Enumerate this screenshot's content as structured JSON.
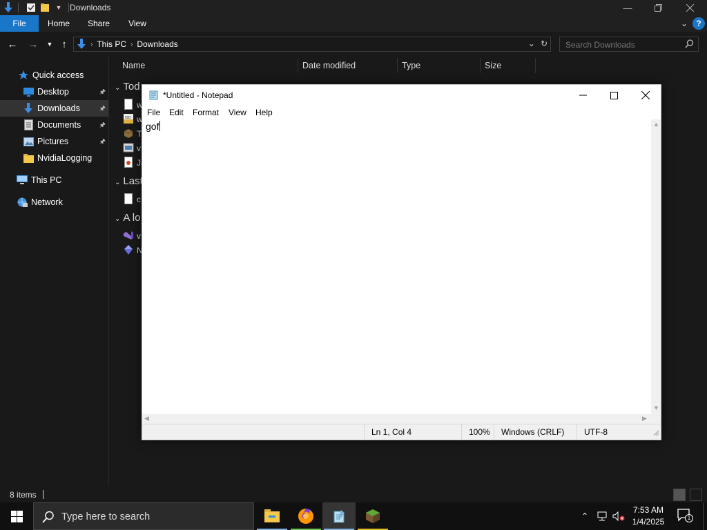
{
  "explorer": {
    "title": "Downloads",
    "ribbon_tabs": [
      "File",
      "Home",
      "Share",
      "View"
    ],
    "breadcrumb": [
      "This PC",
      "Downloads"
    ],
    "search_placeholder": "Search Downloads",
    "nav_items": [
      {
        "label": "Quick access",
        "icon": "star-icon"
      },
      {
        "label": "Desktop",
        "icon": "desktop-icon",
        "pinned": true
      },
      {
        "label": "Downloads",
        "icon": "download-icon",
        "pinned": true,
        "selected": true
      },
      {
        "label": "Documents",
        "icon": "documents-icon",
        "pinned": true
      },
      {
        "label": "Pictures",
        "icon": "pictures-icon",
        "pinned": true
      },
      {
        "label": "NvidiaLogging",
        "icon": "folder-icon"
      },
      {
        "label": "This PC",
        "icon": "computer-icon"
      },
      {
        "label": "Network",
        "icon": "network-icon"
      }
    ],
    "columns": [
      "Name",
      "Date modified",
      "Type",
      "Size"
    ],
    "groups": [
      "Tod",
      "Last",
      "A lo"
    ],
    "file_fragments": [
      "w",
      "w",
      "T",
      "v",
      "Ja",
      "c",
      "v",
      "N"
    ],
    "item_count": "8 items"
  },
  "notepad": {
    "title": "*Untitled - Notepad",
    "menu": [
      "File",
      "Edit",
      "Format",
      "View",
      "Help"
    ],
    "content": "gof",
    "status": {
      "position": "Ln 1, Col 4",
      "zoom": "100%",
      "line_ending": "Windows (CRLF)",
      "encoding": "UTF-8"
    }
  },
  "taskbar": {
    "search_placeholder": "Type here to search",
    "apps": [
      "file-explorer-icon",
      "firefox-icon",
      "notepad-icon",
      "minecraft-icon"
    ],
    "time": "7:53 AM",
    "date": "1/4/2025",
    "notification_count": "1"
  },
  "colors": {
    "accent": "#1a76c9",
    "explorer_bg": "#191919",
    "taskbar_bg": "#101010"
  }
}
